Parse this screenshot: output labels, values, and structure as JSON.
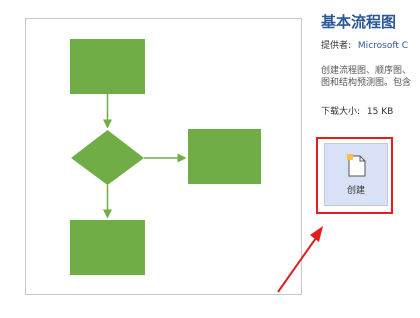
{
  "template": {
    "title": "基本流程图",
    "provider_label": "提供者:",
    "provider_name": "Microsoft C",
    "description_lines": [
      "创建流程图、顺序图、",
      "图和结构预测图。包含"
    ],
    "size_label": "下载大小:",
    "size_value": "15 KB"
  },
  "create_button": {
    "label": "创建",
    "icon": "new-document-icon"
  },
  "colors": {
    "shape_fill": "#70ad47",
    "connector": "#70ad47",
    "title": "#2b5797",
    "highlight": "#e02020",
    "button_bg": "#d8e1f6"
  }
}
